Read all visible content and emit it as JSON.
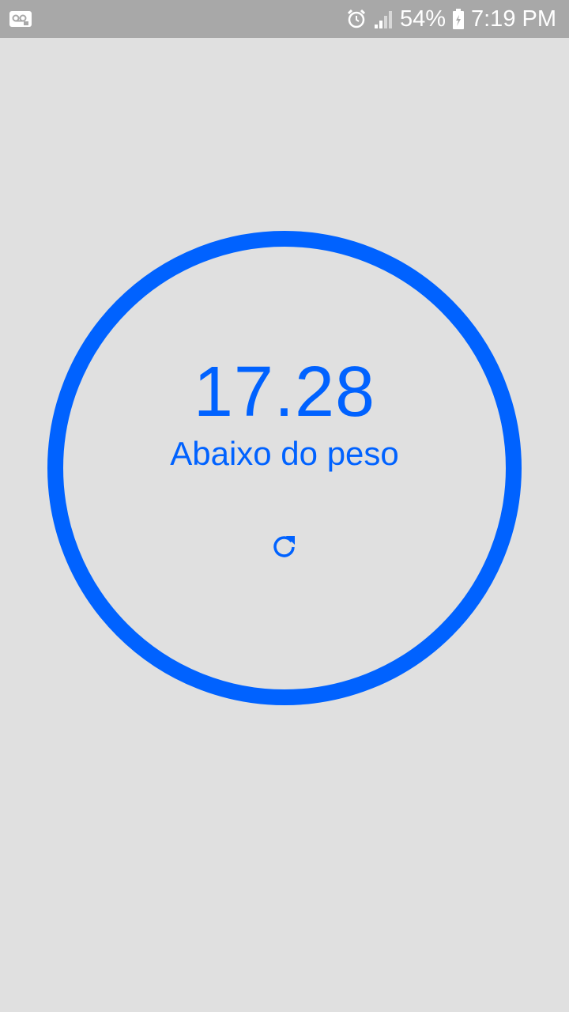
{
  "status_bar": {
    "left_icon": "voicemail-notification-icon",
    "alarm_icon": "alarm-icon",
    "signal_icon": "signal-icon",
    "battery_percent": "54%",
    "battery_icon": "battery-charging-icon",
    "time": "7:19 PM"
  },
  "result": {
    "bmi_value": "17.28",
    "classification": "Abaixo do peso",
    "refresh_icon": "refresh-icon",
    "accent_color": "#0062ff"
  },
  "colors": {
    "background": "#e0e0e0",
    "status_bar": "#a8a8a8"
  }
}
